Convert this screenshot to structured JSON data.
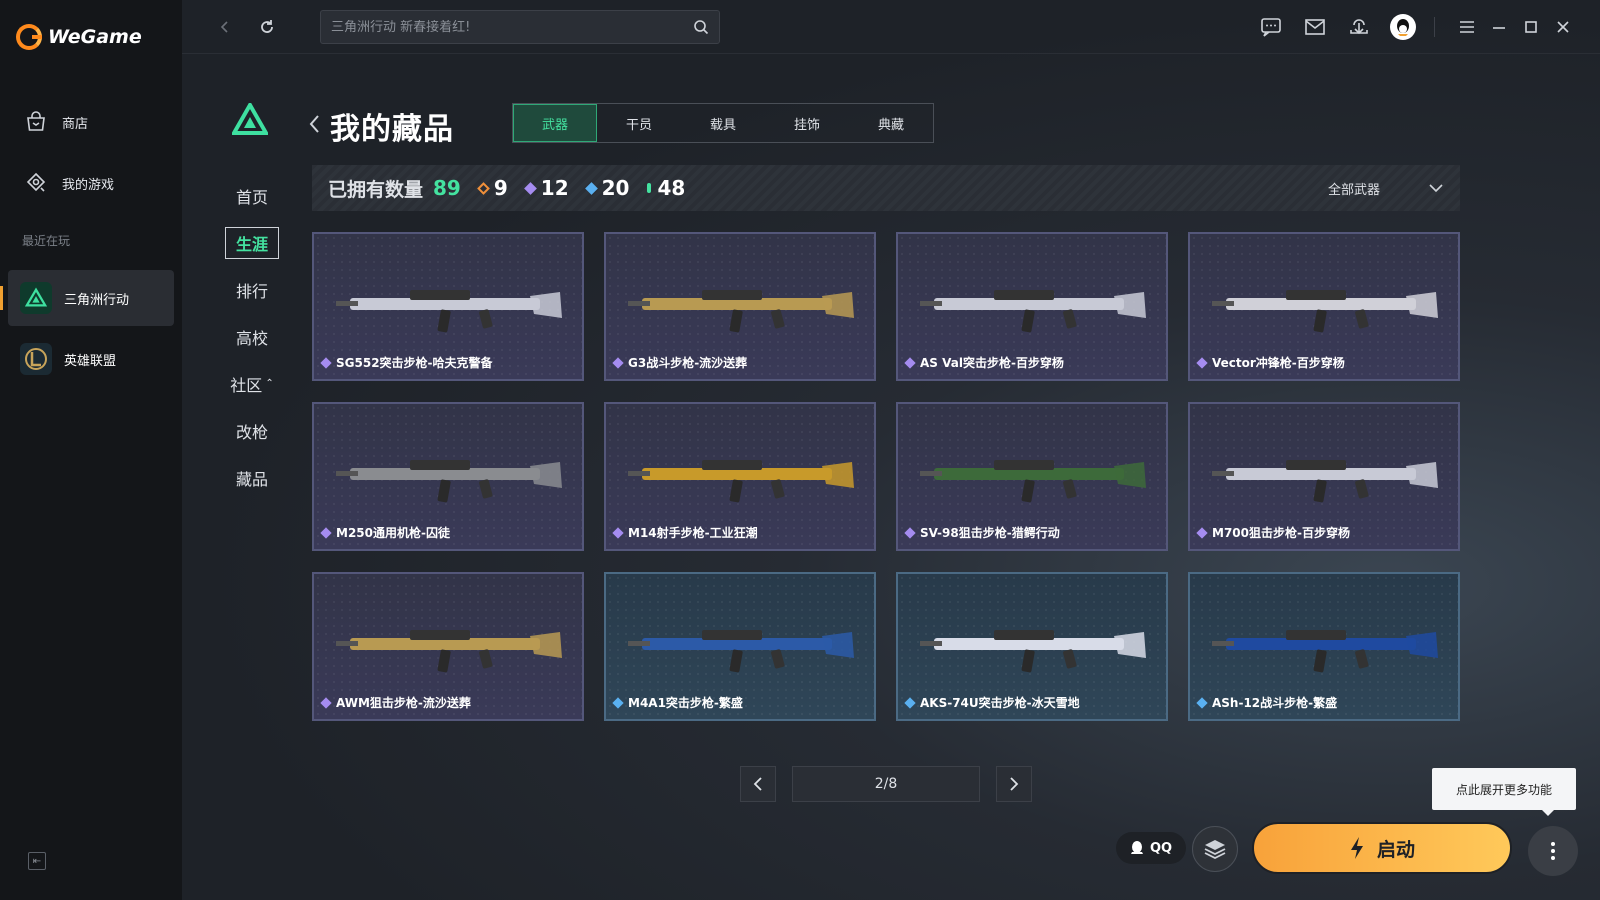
{
  "app": {
    "brand": "WeGame"
  },
  "sidebar": {
    "items": [
      {
        "label": "商店",
        "icon": "store-icon"
      },
      {
        "label": "我的游戏",
        "icon": "games-icon"
      }
    ],
    "recent_label": "最近在玩",
    "recent_games": [
      {
        "label": "三角洲行动",
        "icon": "delta-force-icon",
        "active": true
      },
      {
        "label": "英雄联盟",
        "icon": "lol-icon",
        "active": false
      }
    ]
  },
  "topbar": {
    "search_placeholder": "三角洲行动 新春接着红!"
  },
  "game_nav": {
    "items": [
      "首页",
      "生涯",
      "排行",
      "高校",
      "社区",
      "改枪",
      "藏品"
    ],
    "active_index": 1
  },
  "page": {
    "title": "我的藏品",
    "tabs": [
      "武器",
      "干员",
      "载具",
      "挂饰",
      "典藏"
    ],
    "active_tab": 0
  },
  "stats": {
    "owned_label": "已拥有数量",
    "owned_count": "89",
    "rarities": [
      {
        "count": "9",
        "color": "#f0903a"
      },
      {
        "count": "12",
        "color": "#a58cf0"
      },
      {
        "count": "20",
        "color": "#5ab0f0"
      },
      {
        "count": "48",
        "color": "#44e2a0"
      }
    ],
    "filter_label": "全部武器"
  },
  "cards": [
    {
      "name": "SG552突击步枪-哈夫克警备",
      "rarity_color": "#a58cf0",
      "theme": "purple"
    },
    {
      "name": "G3战斗步枪-流沙送葬",
      "rarity_color": "#a58cf0",
      "theme": "purple"
    },
    {
      "name": "AS Val突击步枪-百步穿杨",
      "rarity_color": "#a58cf0",
      "theme": "purple"
    },
    {
      "name": "Vector冲锋枪-百步穿杨",
      "rarity_color": "#a58cf0",
      "theme": "purple"
    },
    {
      "name": "M250通用机枪-囚徒",
      "rarity_color": "#a58cf0",
      "theme": "purple"
    },
    {
      "name": "M14射手步枪-工业狂潮",
      "rarity_color": "#a58cf0",
      "theme": "purple"
    },
    {
      "name": "SV-98狙击步枪-猎鳄行动",
      "rarity_color": "#a58cf0",
      "theme": "purple"
    },
    {
      "name": "M700狙击步枪-百步穿杨",
      "rarity_color": "#a58cf0",
      "theme": "purple"
    },
    {
      "name": "AWM狙击步枪-流沙送葬",
      "rarity_color": "#a58cf0",
      "theme": "purple"
    },
    {
      "name": "M4A1突击步枪-繁盛",
      "rarity_color": "#5ab0f0",
      "theme": "blue"
    },
    {
      "name": "AKS-74U突击步枪-冰天雪地",
      "rarity_color": "#5ab0f0",
      "theme": "blue"
    },
    {
      "name": "ASh-12战斗步枪-繁盛",
      "rarity_color": "#5ab0f0",
      "theme": "blue"
    }
  ],
  "pager": {
    "text": "2/8"
  },
  "bottom": {
    "tooltip": "点此展开更多功能",
    "qq_label": "QQ",
    "launch_label": "启动"
  }
}
